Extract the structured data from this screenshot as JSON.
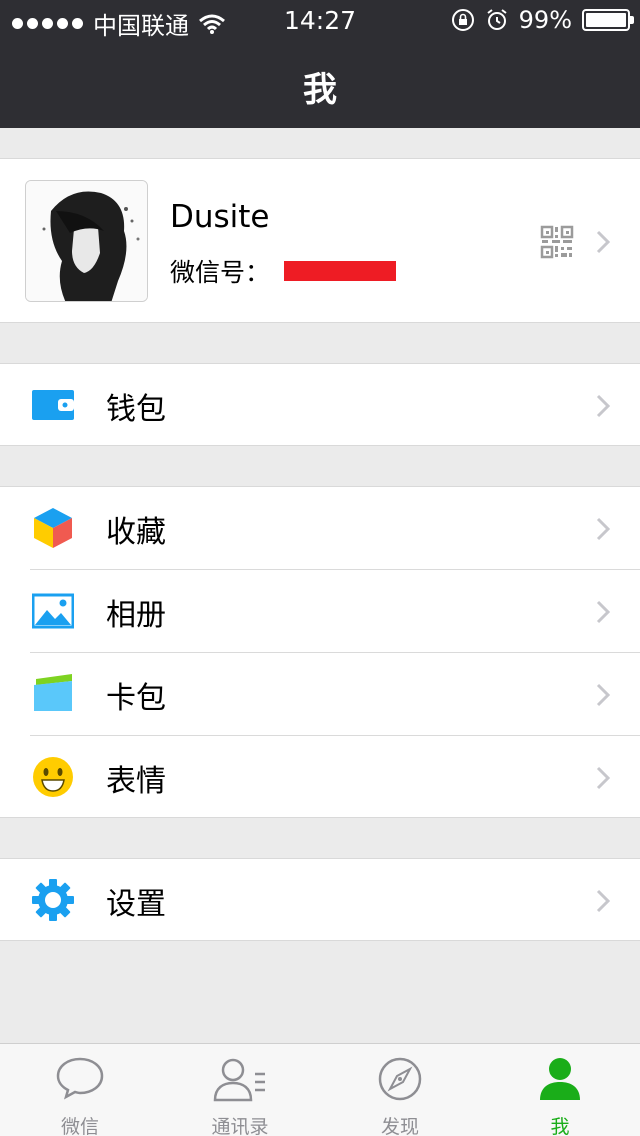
{
  "status": {
    "carrier": "中国联通",
    "time": "14:27",
    "battery": "99%",
    "battery_level": 0.99
  },
  "nav": {
    "title": "我"
  },
  "profile": {
    "name": "Dusite",
    "wechat_id_label": "微信号："
  },
  "menu": {
    "wallet": "钱包",
    "favorites": "收藏",
    "album": "相册",
    "cards": "卡包",
    "stickers": "表情",
    "settings": "设置"
  },
  "tabs": [
    "微信",
    "通讯录",
    "发现",
    "我"
  ],
  "colors": {
    "accent": "#1aad19",
    "blue": "#1aa0f0",
    "header": "#2e2e33"
  }
}
